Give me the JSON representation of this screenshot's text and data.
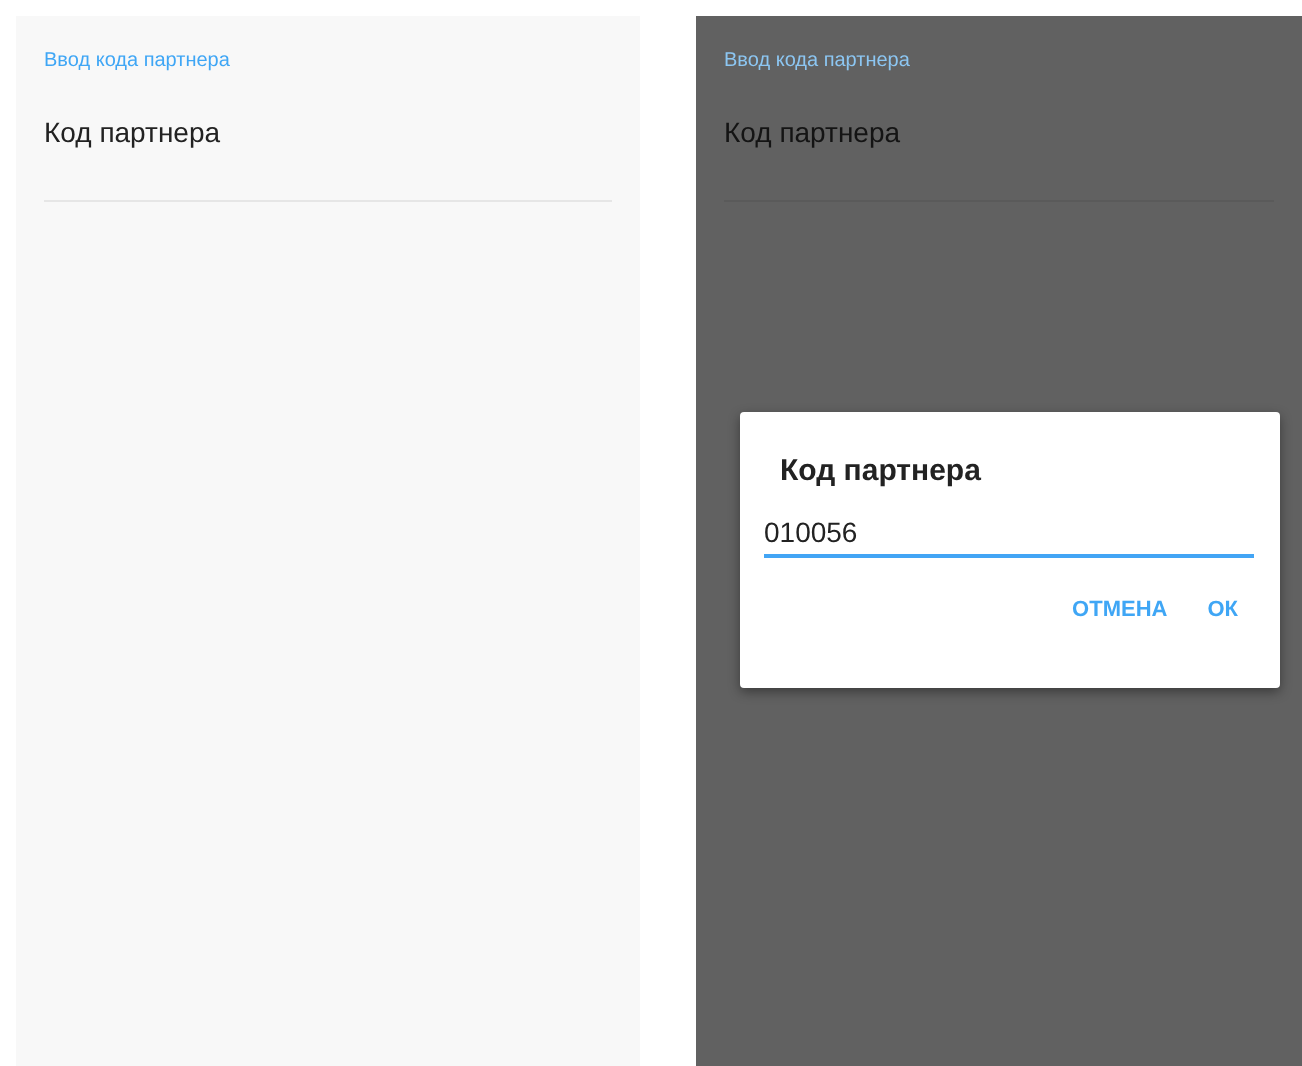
{
  "screens": [
    {
      "header": "Ввод кода партнера",
      "setting_label": "Код партнера",
      "dimmed": false
    },
    {
      "header": "Ввод кода партнера",
      "setting_label": "Код партнера",
      "dimmed": true,
      "dialog": {
        "title": "Код партнера",
        "value": "010056",
        "buttons": [
          "ОТМЕНА",
          "ОК"
        ]
      }
    }
  ]
}
